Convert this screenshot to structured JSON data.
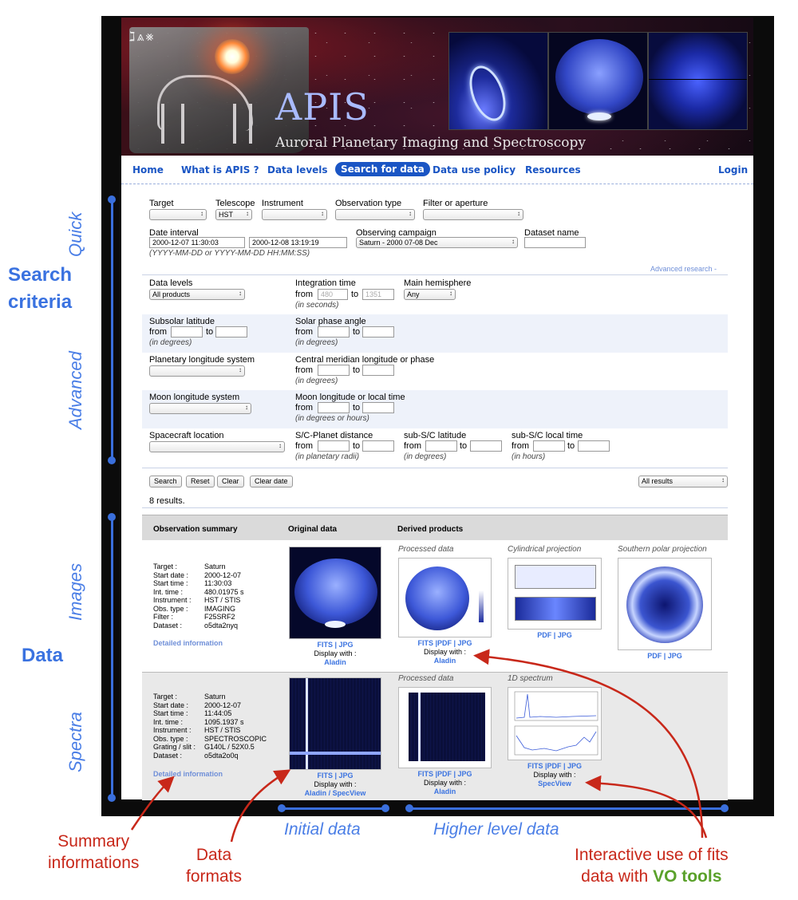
{
  "banner": {
    "glyphs": "ℷ⩓⨳",
    "title": "APIS",
    "subtitle": "Auroral Planetary Imaging and Spectroscopy"
  },
  "nav": {
    "items": [
      "Home",
      "What is APIS ?",
      "Data levels",
      "Search for data",
      "Data use policy",
      "Resources"
    ],
    "login": "Login",
    "active": "Search for data"
  },
  "quick": {
    "target_label": "Target",
    "target_value": "",
    "telescope_label": "Telescope",
    "telescope_value": "HST",
    "instrument_label": "Instrument",
    "instrument_value": "",
    "obs_type_label": "Observation type",
    "obs_type_value": "",
    "filter_label": "Filter or aperture",
    "filter_value": "",
    "date_label": "Date interval",
    "date_from": "2000-12-07 11:30:03",
    "date_to": "2000-12-08 13:19:19",
    "date_hint": "(YYYY-MM-DD or YYYY-MM-DD HH:MM:SS)",
    "campaign_label": "Observing campaign",
    "campaign_value": "Saturn - 2000 07-08 Dec",
    "dataset_label": "Dataset name",
    "dataset_value": ""
  },
  "advanced_link": "Advanced research -",
  "advanced": {
    "data_levels_label": "Data levels",
    "data_levels_value": "All products",
    "integration_label": "Integration time",
    "from": "from",
    "to": "to",
    "integration_from": "480",
    "integration_to": "1351",
    "integration_hint": "(in seconds)",
    "hemisphere_label": "Main hemisphere",
    "hemisphere_value": "Any",
    "subsolar_label": "Subsolar latitude",
    "subsolar_hint": "(in degrees)",
    "phase_label": "Solar phase angle",
    "phase_hint": "(in degrees)",
    "plon_label": "Planetary longitude system",
    "cml_label": "Central meridian longitude or phase",
    "cml_hint": "(in degrees)",
    "moon_label": "Moon longitude system",
    "moonlon_label": "Moon longitude or local time",
    "moonlon_hint": "(in degrees or hours)",
    "sc_label": "Spacecraft location",
    "scdist_label": "S/C-Planet distance",
    "scdist_hint": "(in planetary radii)",
    "sclat_label": "sub-S/C latitude",
    "sclat_hint": "(in degrees)",
    "sclt_label": "sub-S/C local time",
    "sclt_hint": "(in hours)"
  },
  "buttons": {
    "search": "Search",
    "reset": "Reset",
    "clear": "Clear",
    "clear_date": "Clear date",
    "results_select": "All results"
  },
  "result_count": "8 results.",
  "results": {
    "headers": [
      "Observation summary",
      "Original data",
      "Derived products"
    ],
    "row1": {
      "summary": [
        [
          "Target :",
          "Saturn"
        ],
        [
          "Start date :",
          "2000-12-07"
        ],
        [
          "Start time :",
          "11:30:03"
        ],
        [
          "Int. time :",
          "480.01975 s"
        ],
        [
          "Instrument :",
          "HST / STIS"
        ],
        [
          "Obs. type :",
          "IMAGING"
        ],
        [
          "Filter :",
          "F25SRF2"
        ],
        [
          "Dataset :",
          "o5dta2nyq"
        ]
      ],
      "detail": "Detailed information",
      "captions": [
        "Processed data",
        "Cylindrical projection",
        "Southern polar projection"
      ],
      "orig_links": "FITS | JPG",
      "display_with": "Display with :",
      "orig_tool": "Aladin",
      "proc_links": "FITS |PDF | JPG",
      "proc_tool": "Aladin",
      "cyl_links": "PDF | JPG",
      "pol_links": "PDF | JPG"
    },
    "row2": {
      "summary": [
        [
          "Target :",
          "Saturn"
        ],
        [
          "Start date :",
          "2000-12-07"
        ],
        [
          "Start time :",
          "11:44:05"
        ],
        [
          "Int. time :",
          "1095.1937 s"
        ],
        [
          "Instrument :",
          "HST / STIS"
        ],
        [
          "Obs. type :",
          "SPECTROSCOPIC"
        ],
        [
          "Grating / slit :",
          "G140L / 52X0.5"
        ],
        [
          "Dataset :",
          "o5dta2o0q"
        ]
      ],
      "detail": "Detailed information",
      "captions": [
        "Processed data",
        "1D spectrum"
      ],
      "orig_links": "FITS | JPG",
      "display_with": "Display with :",
      "orig_tool": "Aladin / SpecView",
      "proc_links": "FITS |PDF | JPG",
      "proc_tool": "Aladin",
      "spec_links": "FITS |PDF | JPG",
      "spec_tool": "SpecView"
    }
  },
  "annotations": {
    "quick": "Quick",
    "search_criteria": "Search\ncriteria",
    "advanced": "Advanced",
    "images": "Images",
    "data": "Data",
    "spectra": "Spectra",
    "summary": "Summary\ninformations",
    "formats": "Data\nformats",
    "initial": "Initial data",
    "higher": "Higher level data",
    "interactive_1": "Interactive use of fits",
    "interactive_2": "data with ",
    "vo": "VO tools"
  },
  "colors": {
    "accent": "#1a55c4",
    "annotation_blue": "#4a7ee6",
    "annotation_red": "#c8281a",
    "vo_green": "#5aa12a"
  }
}
